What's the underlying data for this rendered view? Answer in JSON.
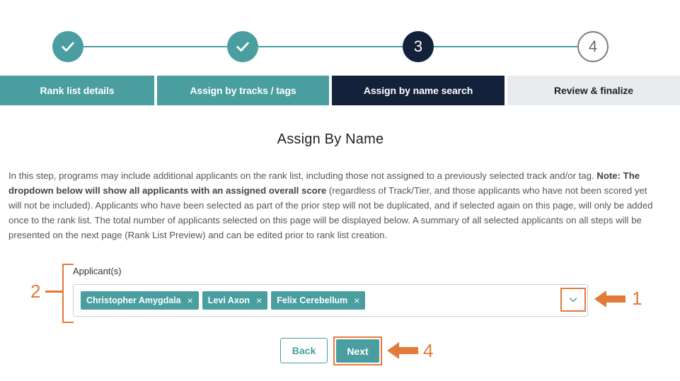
{
  "stepper": {
    "steps": [
      {
        "number": "1",
        "label": "Rank list details",
        "state": "done",
        "icon": "check-icon"
      },
      {
        "number": "2",
        "label": "Assign by tracks / tags",
        "state": "done",
        "icon": "check-icon"
      },
      {
        "number": "3",
        "label": "Assign by name search",
        "state": "active"
      },
      {
        "number": "4",
        "label": "Review & finalize",
        "state": "pending"
      }
    ]
  },
  "page": {
    "title": "Assign By Name",
    "description_intro": "In this step, programs may include additional applicants on the rank list, including those not assigned to a previously selected track and/or tag. ",
    "description_note": "Note: The dropdown below will show all applicants with an assigned overall score",
    "description_rest": " (regardless of Track/Tier, and those applicants who have not been scored yet will not be included). Applicants who have been selected as part of the prior step will not be duplicated, and if selected again on this page, will only be added once to the rank list. The total number of applicants selected on this page will be displayed below. A summary of all selected applicants on all steps will be presented on the next page (Rank List Preview) and can be edited prior to rank list creation."
  },
  "applicants": {
    "label": "Applicant(s)",
    "selected": [
      "Christopher Amygdala",
      "Levi Axon",
      "Felix Cerebellum"
    ],
    "remove_symbol": "×"
  },
  "actions": {
    "back_label": "Back",
    "next_label": "Next"
  },
  "annotations": {
    "callout_1": "1",
    "callout_2": "2",
    "callout_4": "4",
    "color": "#e27a3a"
  },
  "colors": {
    "teal": "#4a9ea0",
    "navy": "#14213a",
    "pending_tab": "#e9ecee"
  }
}
